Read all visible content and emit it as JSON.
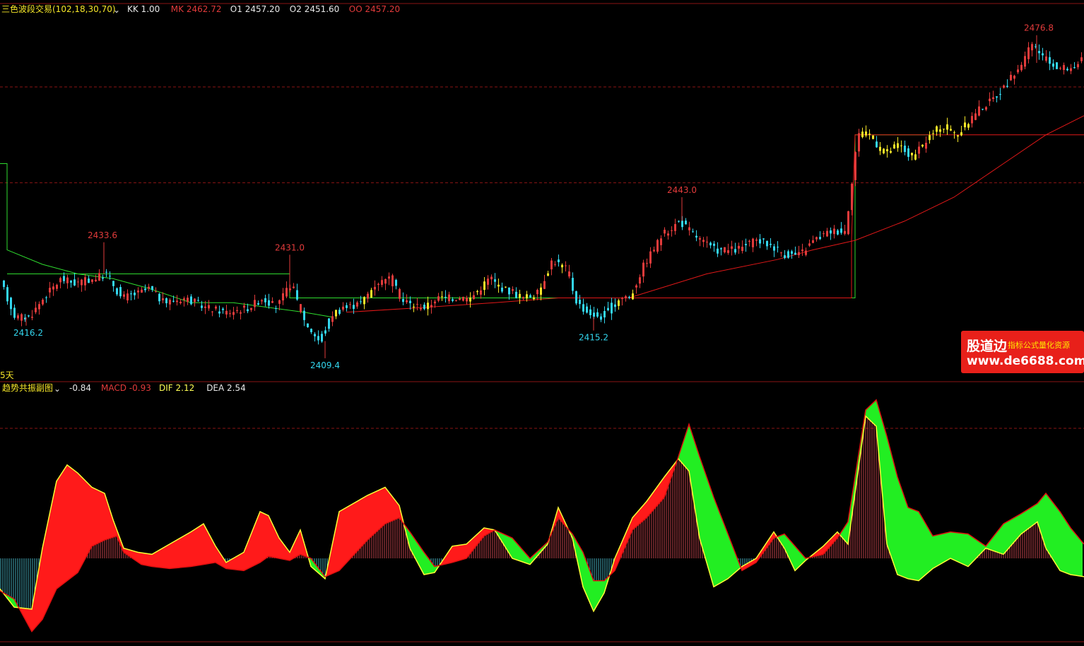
{
  "top_panel": {
    "indicator_name": "三色波段交易(102,18,30,70)",
    "dropdown_glyph": "⌄",
    "readouts": [
      {
        "label": "KK 1.00",
        "color": "#e8e8e8"
      },
      {
        "label": "MK 2462.72",
        "color": "#e23b3b"
      },
      {
        "label": "O1 2457.20",
        "color": "#e8e8e8"
      },
      {
        "label": "O2 2451.60",
        "color": "#e8e8e8"
      },
      {
        "label": "OO 2457.20",
        "color": "#e23b3b"
      }
    ],
    "period_label": "5天"
  },
  "bottom_panel": {
    "indicator_name": "趋势共振副图",
    "dropdown_glyph": "⌄",
    "readouts": [
      {
        "label": "-0.84",
        "color": "#e8e8e8"
      },
      {
        "label": "MACD -0.93",
        "color": "#e23b3b"
      },
      {
        "label": "DIF 2.12",
        "color": "#ffff55"
      },
      {
        "label": "DEA 2.54",
        "color": "#e8e8e8"
      }
    ]
  },
  "watermark": {
    "brand": "股道边",
    "tagline": "指标公式量化资源",
    "url": "www.de6688.com"
  },
  "colors": {
    "up": "#e23b3b",
    "down": "#33d6ee",
    "neutral": "#f5e628",
    "green_line": "#2fdc2f",
    "red_line": "#e01818",
    "grid": "#8a1515",
    "dif": "#ffff33",
    "dea": "#e01010",
    "ribbon_up": "#ff1a1a",
    "ribbon_down": "#22ee22"
  },
  "chart_data": [
    {
      "type": "candlestick",
      "ylim": [
        2406,
        2480
      ],
      "price_labels": [
        {
          "text": "2433.6",
          "value": 2433.6,
          "kind": "high"
        },
        {
          "text": "2431.0",
          "value": 2431.0,
          "kind": "high"
        },
        {
          "text": "2443.0",
          "value": 2443.0,
          "kind": "high"
        },
        {
          "text": "2476.8",
          "value": 2476.8,
          "kind": "high"
        },
        {
          "text": "2416.2",
          "value": 2416.2,
          "kind": "low"
        },
        {
          "text": "2409.4",
          "value": 2409.4,
          "kind": "low"
        },
        {
          "text": "2415.2",
          "value": 2415.2,
          "kind": "low"
        }
      ],
      "price_path": [
        [
          0,
          2425
        ],
        [
          20,
          2418
        ],
        [
          40,
          2418
        ],
        [
          60,
          2422
        ],
        [
          85,
          2426
        ],
        [
          105,
          2425
        ],
        [
          130,
          2426
        ],
        [
          150,
          2427
        ],
        [
          170,
          2422
        ],
        [
          195,
          2423
        ],
        [
          210,
          2424
        ],
        [
          230,
          2421
        ],
        [
          260,
          2422
        ],
        [
          290,
          2420
        ],
        [
          320,
          2419
        ],
        [
          350,
          2420
        ],
        [
          370,
          2422
        ],
        [
          390,
          2420
        ],
        [
          410,
          2425
        ],
        [
          430,
          2417
        ],
        [
          450,
          2413
        ],
        [
          470,
          2419
        ],
        [
          490,
          2420
        ],
        [
          510,
          2421
        ],
        [
          530,
          2425
        ],
        [
          550,
          2426
        ],
        [
          570,
          2421
        ],
        [
          600,
          2420
        ],
        [
          620,
          2422
        ],
        [
          640,
          2422
        ],
        [
          665,
          2422
        ],
        [
          690,
          2426
        ],
        [
          710,
          2424
        ],
        [
          740,
          2422
        ],
        [
          760,
          2423
        ],
        [
          780,
          2430
        ],
        [
          800,
          2428
        ],
        [
          815,
          2421
        ],
        [
          830,
          2419
        ],
        [
          850,
          2418
        ],
        [
          875,
          2422
        ],
        [
          890,
          2422
        ],
        [
          910,
          2429
        ],
        [
          935,
          2435
        ],
        [
          960,
          2438
        ],
        [
          990,
          2434
        ],
        [
          1010,
          2432
        ],
        [
          1040,
          2432
        ],
        [
          1070,
          2434
        ],
        [
          1090,
          2433
        ],
        [
          1110,
          2431
        ],
        [
          1130,
          2431
        ],
        [
          1150,
          2434
        ],
        [
          1175,
          2436
        ],
        [
          1195,
          2436
        ],
        [
          1212,
          2456
        ],
        [
          1230,
          2456
        ],
        [
          1250,
          2452
        ],
        [
          1270,
          2454
        ],
        [
          1290,
          2451
        ],
        [
          1310,
          2455
        ],
        [
          1330,
          2458
        ],
        [
          1355,
          2456
        ],
        [
          1380,
          2461
        ],
        [
          1400,
          2463
        ],
        [
          1420,
          2466
        ],
        [
          1440,
          2470
        ],
        [
          1460,
          2475
        ],
        [
          1475,
          2472
        ],
        [
          1495,
          2470
        ],
        [
          1515,
          2470
        ],
        [
          1534,
          2472
        ]
      ],
      "green_line": [
        [
          0,
          2450
        ],
        [
          10,
          2450
        ],
        [
          10,
          2432
        ],
        [
          60,
          2429
        ],
        [
          110,
          2427
        ],
        [
          160,
          2426
        ],
        [
          210,
          2424
        ],
        [
          270,
          2421
        ],
        [
          330,
          2421
        ],
        [
          380,
          2420
        ],
        [
          430,
          2419
        ],
        [
          470,
          2418
        ]
      ],
      "green_step": [
        [
          10,
          2427
        ],
        [
          410,
          2427
        ],
        [
          410,
          2422
        ],
        [
          870,
          2422
        ],
        [
          1210,
          2422
        ],
        [
          1210,
          2456
        ],
        [
          1320,
          2456
        ]
      ],
      "red_step": [
        [
          890,
          2422
        ],
        [
          1205,
          2422
        ],
        [
          1205,
          2434
        ],
        [
          1210,
          2456
        ],
        [
          1534,
          2456
        ]
      ],
      "red_curve": [
        [
          490,
          2419
        ],
        [
          600,
          2420
        ],
        [
          700,
          2421
        ],
        [
          790,
          2422
        ],
        [
          890,
          2422
        ],
        [
          1000,
          2427
        ],
        [
          1100,
          2430
        ],
        [
          1150,
          2432
        ],
        [
          1210,
          2434
        ],
        [
          1280,
          2438
        ],
        [
          1350,
          2443
        ],
        [
          1420,
          2450
        ],
        [
          1480,
          2456
        ],
        [
          1534,
          2460
        ]
      ],
      "grid_levels": [
        2466,
        2446
      ]
    },
    {
      "type": "macd",
      "ylim": [
        -4,
        8
      ],
      "dif": [
        [
          0,
          -1.5
        ],
        [
          20,
          -2.4
        ],
        [
          45,
          -2.5
        ],
        [
          60,
          0.5
        ],
        [
          80,
          3.8
        ],
        [
          95,
          4.6
        ],
        [
          110,
          4.2
        ],
        [
          130,
          3.5
        ],
        [
          148,
          3.2
        ],
        [
          160,
          1.9
        ],
        [
          175,
          0.5
        ],
        [
          195,
          0.3
        ],
        [
          215,
          0.2
        ],
        [
          240,
          0.7
        ],
        [
          270,
          1.3
        ],
        [
          288,
          1.7
        ],
        [
          305,
          0.6
        ],
        [
          320,
          -0.2
        ],
        [
          345,
          0.3
        ],
        [
          368,
          2.3
        ],
        [
          380,
          2.1
        ],
        [
          395,
          1.0
        ],
        [
          410,
          0.3
        ],
        [
          425,
          1.4
        ],
        [
          440,
          -0.4
        ],
        [
          460,
          -1.0
        ],
        [
          480,
          2.3
        ],
        [
          520,
          3.1
        ],
        [
          545,
          3.5
        ],
        [
          565,
          2.6
        ],
        [
          580,
          0.5
        ],
        [
          600,
          -0.8
        ],
        [
          615,
          -0.7
        ],
        [
          640,
          0.6
        ],
        [
          660,
          0.7
        ],
        [
          685,
          1.5
        ],
        [
          700,
          1.4
        ],
        [
          725,
          0.0
        ],
        [
          750,
          -0.3
        ],
        [
          775,
          0.7
        ],
        [
          790,
          2.5
        ],
        [
          810,
          1.0
        ],
        [
          825,
          -1.4
        ],
        [
          840,
          -2.6
        ],
        [
          855,
          -1.7
        ],
        [
          870,
          0.0
        ],
        [
          895,
          2.0
        ],
        [
          915,
          2.8
        ],
        [
          940,
          4.0
        ],
        [
          960,
          4.9
        ],
        [
          975,
          4.3
        ],
        [
          990,
          1.0
        ],
        [
          1010,
          -1.4
        ],
        [
          1030,
          -1.0
        ],
        [
          1050,
          -0.4
        ],
        [
          1070,
          0.0
        ],
        [
          1095,
          1.3
        ],
        [
          1110,
          0.5
        ],
        [
          1125,
          -0.6
        ],
        [
          1140,
          -0.1
        ],
        [
          1165,
          0.6
        ],
        [
          1185,
          1.3
        ],
        [
          1200,
          0.7
        ],
        [
          1225,
          7.0
        ],
        [
          1240,
          6.5
        ],
        [
          1255,
          0.7
        ],
        [
          1270,
          -0.8
        ],
        [
          1285,
          -1.0
        ],
        [
          1300,
          -1.1
        ],
        [
          1320,
          -0.5
        ],
        [
          1345,
          0.0
        ],
        [
          1370,
          -0.4
        ],
        [
          1395,
          0.5
        ],
        [
          1420,
          0.2
        ],
        [
          1445,
          1.2
        ],
        [
          1468,
          1.8
        ],
        [
          1480,
          0.5
        ],
        [
          1500,
          -0.6
        ],
        [
          1515,
          -0.8
        ],
        [
          1534,
          -0.9
        ]
      ],
      "dea": [
        [
          0,
          -1.6
        ],
        [
          20,
          -2.0
        ],
        [
          45,
          -3.6
        ],
        [
          60,
          -3.0
        ],
        [
          80,
          -1.5
        ],
        [
          110,
          -0.7
        ],
        [
          130,
          0.6
        ],
        [
          148,
          0.9
        ],
        [
          165,
          1.1
        ],
        [
          175,
          0.3
        ],
        [
          200,
          -0.3
        ],
        [
          215,
          -0.4
        ],
        [
          240,
          -0.5
        ],
        [
          270,
          -0.4
        ],
        [
          288,
          -0.3
        ],
        [
          305,
          -0.2
        ],
        [
          320,
          -0.5
        ],
        [
          345,
          -0.6
        ],
        [
          368,
          -0.2
        ],
        [
          380,
          0.1
        ],
        [
          395,
          0.0
        ],
        [
          410,
          -0.1
        ],
        [
          425,
          0.2
        ],
        [
          440,
          0.0
        ],
        [
          460,
          -0.9
        ],
        [
          480,
          -0.6
        ],
        [
          520,
          0.9
        ],
        [
          545,
          1.7
        ],
        [
          565,
          2.0
        ],
        [
          580,
          1.3
        ],
        [
          600,
          0.3
        ],
        [
          615,
          -0.4
        ],
        [
          640,
          -0.2
        ],
        [
          660,
          0.0
        ],
        [
          685,
          1.1
        ],
        [
          700,
          1.4
        ],
        [
          725,
          1.0
        ],
        [
          750,
          0.0
        ],
        [
          775,
          0.8
        ],
        [
          790,
          2.0
        ],
        [
          810,
          1.2
        ],
        [
          825,
          0.3
        ],
        [
          840,
          -1.1
        ],
        [
          855,
          -1.1
        ],
        [
          870,
          -0.6
        ],
        [
          895,
          1.4
        ],
        [
          915,
          2.0
        ],
        [
          940,
          3.0
        ],
        [
          960,
          5.0
        ],
        [
          975,
          6.6
        ],
        [
          990,
          5.0
        ],
        [
          1010,
          3.0
        ],
        [
          1030,
          1.2
        ],
        [
          1050,
          -0.6
        ],
        [
          1070,
          -0.2
        ],
        [
          1095,
          1.0
        ],
        [
          1110,
          1.2
        ],
        [
          1125,
          0.6
        ],
        [
          1140,
          0.0
        ],
        [
          1165,
          0.2
        ],
        [
          1185,
          1.0
        ],
        [
          1200,
          1.8
        ],
        [
          1225,
          7.3
        ],
        [
          1240,
          7.8
        ],
        [
          1255,
          6.0
        ],
        [
          1270,
          4.0
        ],
        [
          1285,
          2.5
        ],
        [
          1300,
          2.3
        ],
        [
          1320,
          1.1
        ],
        [
          1345,
          1.3
        ],
        [
          1370,
          1.2
        ],
        [
          1395,
          0.6
        ],
        [
          1420,
          1.7
        ],
        [
          1445,
          2.2
        ],
        [
          1468,
          2.7
        ],
        [
          1480,
          3.2
        ],
        [
          1500,
          2.3
        ],
        [
          1515,
          1.5
        ],
        [
          1534,
          0.7
        ]
      ],
      "grid_levels": [
        6.4
      ],
      "zero_level": 0
    }
  ]
}
